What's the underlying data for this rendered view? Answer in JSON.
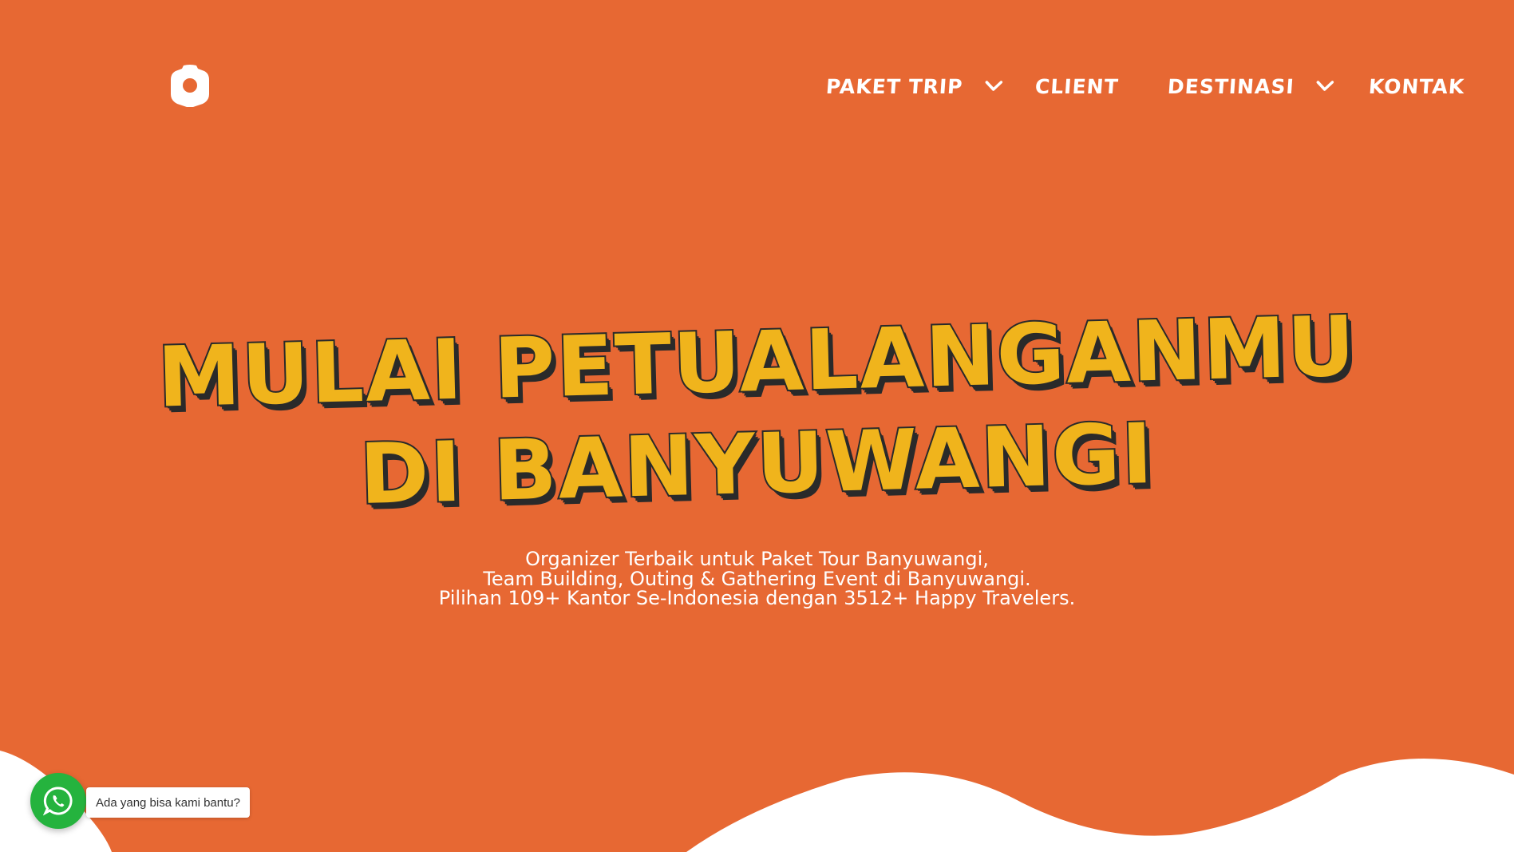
{
  "header": {
    "logo_icon": "brand-logo-icon",
    "nav": [
      {
        "label": "PAKET TRIP",
        "has_dropdown": true
      },
      {
        "label": "CLIENT",
        "has_dropdown": false
      },
      {
        "label": "DESTINASI",
        "has_dropdown": true
      },
      {
        "label": "KONTAK",
        "has_dropdown": false
      }
    ]
  },
  "hero": {
    "title_line1": "MULAI PETUALANGANMU",
    "title_line2": "DI BANYUWANGI",
    "subtitle_line1": "Organizer Terbaik untuk Paket Tour Banyuwangi,",
    "subtitle_line2": "Team Building, Outing & Gathering Event di Banyuwangi.",
    "subtitle_line3": "Pilihan 109+ Kantor Se-Indonesia dengan 3512+ Happy Travelers."
  },
  "whatsapp": {
    "icon": "whatsapp-icon",
    "bubble_text": "Ada yang bisa kami bantu?"
  },
  "colors": {
    "background": "#E76833",
    "title_fill": "#F0B41C",
    "title_outline": "#2A2A2A",
    "whatsapp_green": "#25B33E",
    "wave": "#FFFFFF"
  }
}
